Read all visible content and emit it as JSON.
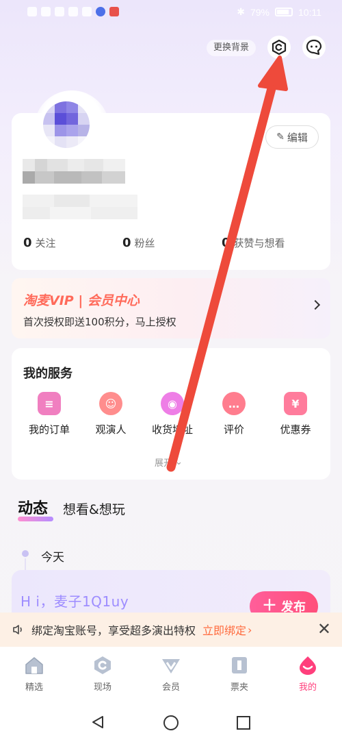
{
  "status_bar": {
    "battery_text": "79%",
    "time": "10:11"
  },
  "header": {
    "change_bg_label": "更换背景"
  },
  "profile": {
    "edit_label": "编辑",
    "stats": [
      {
        "num": "0",
        "label": "关注"
      },
      {
        "num": "0",
        "label": "粉丝"
      },
      {
        "num": "0",
        "label": "获赞与想看"
      }
    ]
  },
  "vip": {
    "title": "淘麦VIP | 会员中心",
    "subtitle": "首次授权即送100积分，马上授权"
  },
  "services": {
    "title": "我的服务",
    "items": [
      {
        "label": "我的订单",
        "icon": "order-icon",
        "color": "#f07fc0",
        "glyph": "≡"
      },
      {
        "label": "观演人",
        "icon": "viewer-icon",
        "color": "#ff8d8d",
        "glyph": "☺"
      },
      {
        "label": "收货地址",
        "icon": "address-icon",
        "color": "#ee7ee6",
        "glyph": "◉"
      },
      {
        "label": "评价",
        "icon": "comment-icon",
        "color": "#ff7d8e",
        "glyph": "…"
      },
      {
        "label": "优惠券",
        "icon": "coupon-icon",
        "color": "#ff7c9c",
        "glyph": "¥"
      }
    ],
    "expand_label": "展开"
  },
  "dynamics": {
    "tab_active": "动态",
    "tab_other": "想看&想玩",
    "today_label": "今天",
    "greeting": "H i，麦子1Q1uy",
    "publish_label": "发布"
  },
  "bind_banner": {
    "text": "绑定淘宝账号，享受超多演出特权",
    "action": "立即绑定"
  },
  "bottom_nav": [
    {
      "label": "精选",
      "icon": "home-icon"
    },
    {
      "label": "现场",
      "icon": "live-icon"
    },
    {
      "label": "会员",
      "icon": "vip-icon"
    },
    {
      "label": "票夹",
      "icon": "ticket-icon"
    },
    {
      "label": "我的",
      "icon": "mine-icon",
      "active": true
    }
  ],
  "colors": {
    "accent": "#ff3f7c",
    "annotation_arrow": "#ee4a3b",
    "vip_orange": "#ff6a5a"
  }
}
